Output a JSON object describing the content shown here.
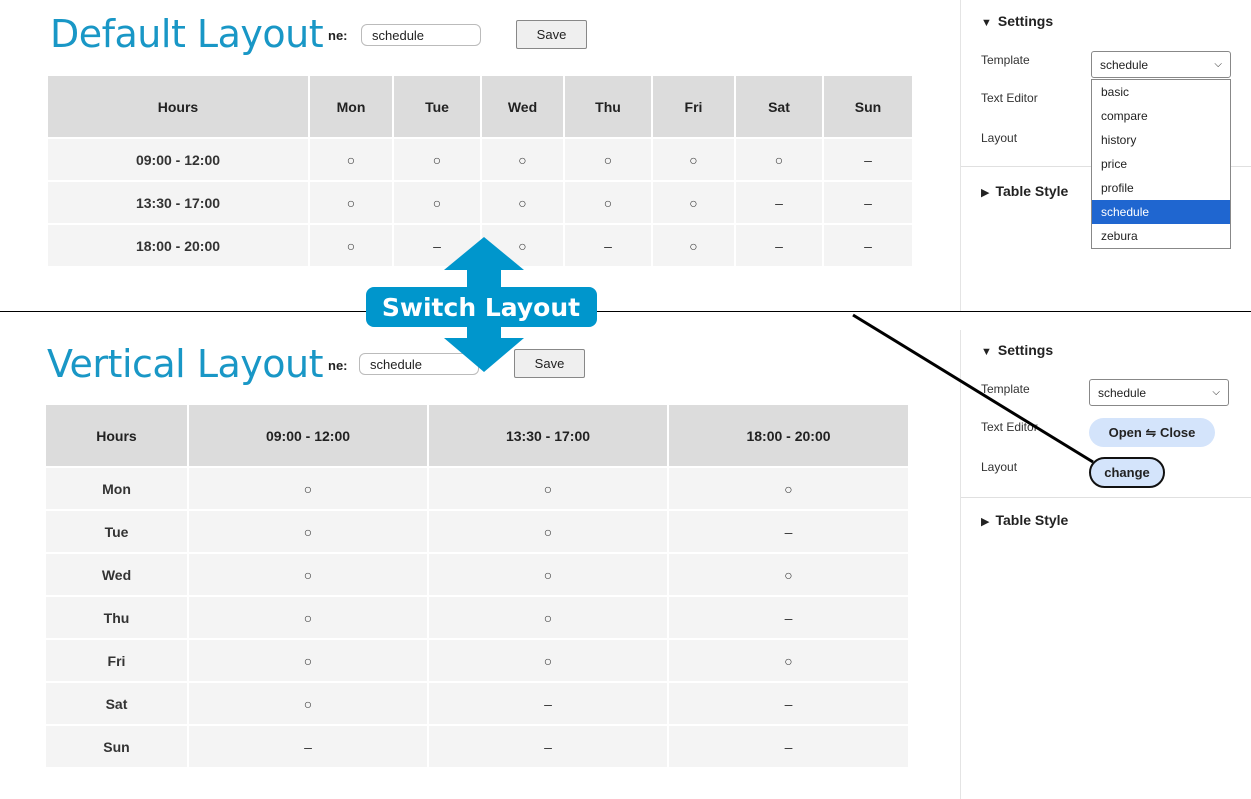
{
  "default_view": {
    "title": "Default Layout",
    "name_label": "ne:",
    "name_value": "schedule",
    "save_label": "Save",
    "table": {
      "headers": [
        "Hours",
        "Mon",
        "Tue",
        "Wed",
        "Thu",
        "Fri",
        "Sat",
        "Sun"
      ],
      "rows": [
        [
          "09:00 - 12:00",
          "○",
          "○",
          "○",
          "○",
          "○",
          "○",
          "–"
        ],
        [
          "13:30 - 17:00",
          "○",
          "○",
          "○",
          "○",
          "○",
          "–",
          "–"
        ],
        [
          "18:00 - 20:00",
          "○",
          "–",
          "○",
          "–",
          "○",
          "–",
          "–"
        ]
      ]
    }
  },
  "vertical_view": {
    "title": "Vertical Layout",
    "name_label": "ne:",
    "name_value": "schedule",
    "save_label": "Save",
    "table": {
      "headers": [
        "Hours",
        "09:00 - 12:00",
        "13:30 - 17:00",
        "18:00 - 20:00"
      ],
      "rows": [
        [
          "Mon",
          "○",
          "○",
          "○"
        ],
        [
          "Tue",
          "○",
          "○",
          "–"
        ],
        [
          "Wed",
          "○",
          "○",
          "○"
        ],
        [
          "Thu",
          "○",
          "○",
          "–"
        ],
        [
          "Fri",
          "○",
          "○",
          "○"
        ],
        [
          "Sat",
          "○",
          "–",
          "–"
        ],
        [
          "Sun",
          "–",
          "–",
          "–"
        ]
      ]
    }
  },
  "sidebar_top": {
    "settings_label": "Settings",
    "template_label": "Template",
    "template_value": "schedule",
    "text_editor_label": "Text Editor",
    "layout_label": "Layout",
    "table_style_label": "Table Style",
    "dropdown_options": [
      "basic",
      "compare",
      "history",
      "price",
      "profile",
      "schedule",
      "zebura"
    ],
    "dropdown_selected": "schedule"
  },
  "sidebar_bottom": {
    "settings_label": "Settings",
    "template_label": "Template",
    "template_value": "schedule",
    "text_editor_label": "Text Editor",
    "text_editor_button": "Open ⇋ Close",
    "layout_label": "Layout",
    "layout_button": "change",
    "table_style_label": "Table Style"
  },
  "overlay": {
    "switch_label": "Switch Layout",
    "accent_color": "#0096cc"
  }
}
